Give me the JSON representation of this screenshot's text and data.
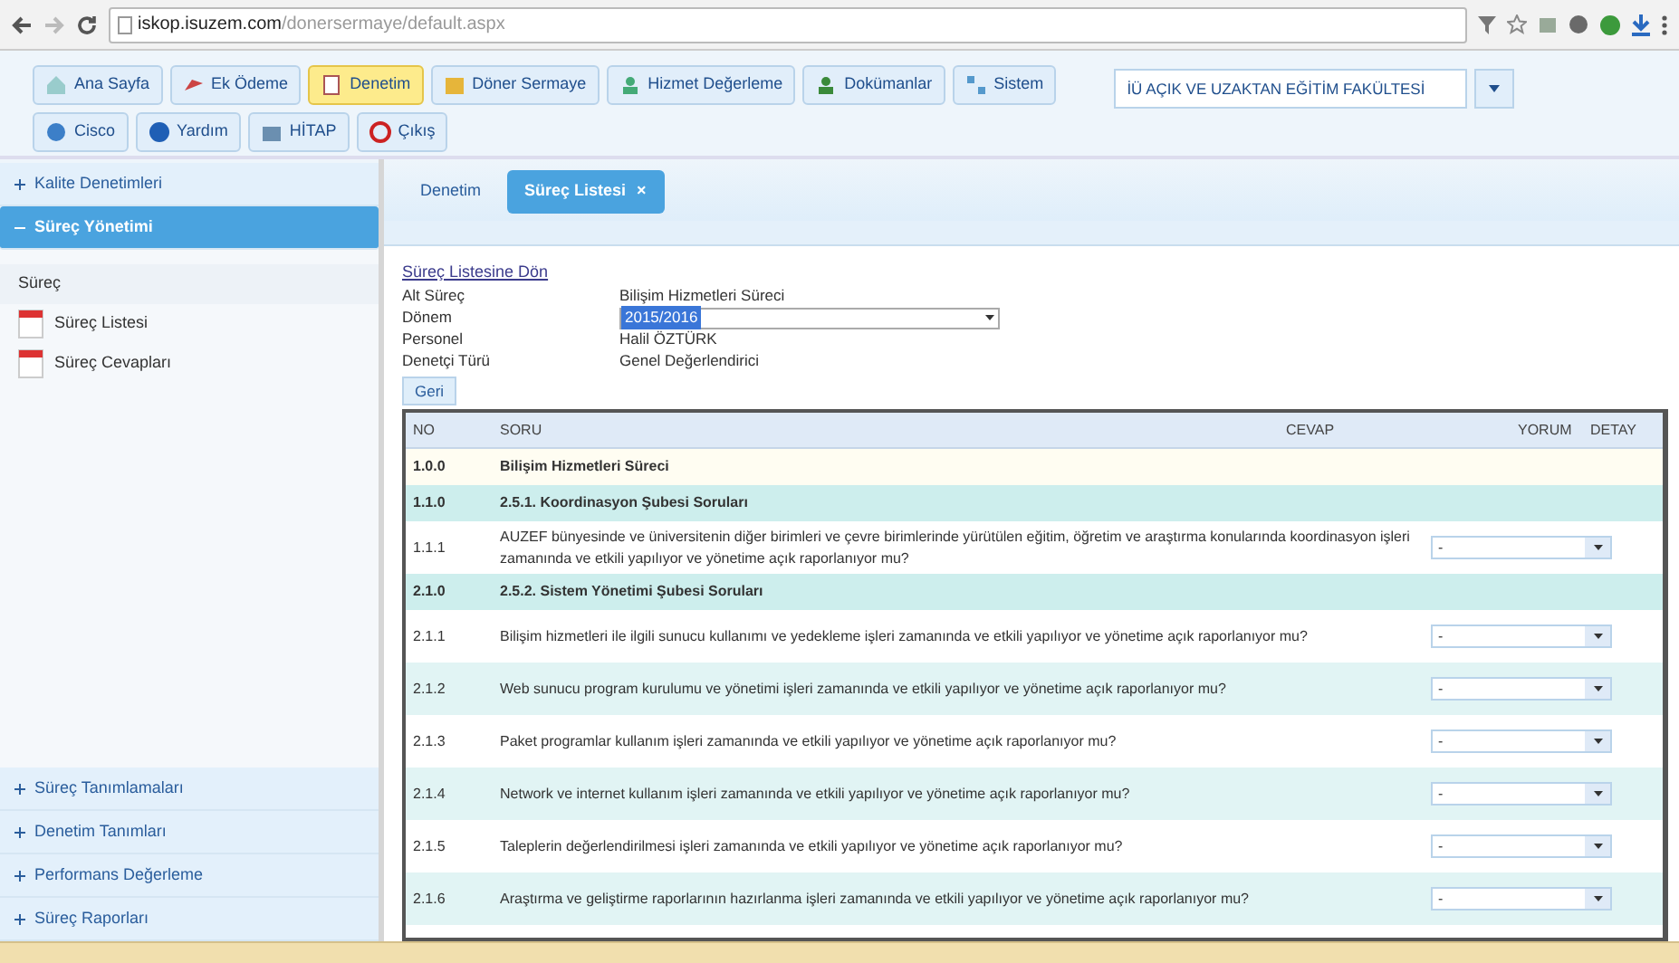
{
  "browser": {
    "url_host": "iskop.isuzem.com",
    "url_path": "/donersermaye/default.aspx"
  },
  "menu": {
    "rows": [
      [
        {
          "label": "Ana Sayfa",
          "selected": false
        },
        {
          "label": "Ek Ödeme",
          "selected": false
        },
        {
          "label": "Denetim",
          "selected": true
        },
        {
          "label": "Döner Sermaye",
          "selected": false
        },
        {
          "label": "Hizmet Değerleme",
          "selected": false
        },
        {
          "label": "Dokümanlar",
          "selected": false
        },
        {
          "label": "Sistem",
          "selected": false
        }
      ],
      [
        {
          "label": "Cisco",
          "selected": false
        },
        {
          "label": "Yardım",
          "selected": false
        },
        {
          "label": "HİTAP",
          "selected": false
        },
        {
          "label": "Çıkış",
          "selected": false
        }
      ]
    ]
  },
  "faculty_select": {
    "value": "İÜ AÇIK VE UZAKTAN EĞİTİM FAKÜLTESİ"
  },
  "sidebar": {
    "sections": [
      {
        "label": "Kalite Denetimleri",
        "expanded": false
      },
      {
        "label": "Süreç Yönetimi",
        "expanded": true,
        "heading": "Süreç",
        "items": [
          "Süreç Listesi",
          "Süreç Cevapları"
        ]
      },
      {
        "label": "Süreç Tanımlamaları",
        "expanded": false
      },
      {
        "label": "Denetim Tanımları",
        "expanded": false
      },
      {
        "label": "Performans Değerleme",
        "expanded": false
      },
      {
        "label": "Süreç Raporları",
        "expanded": false
      }
    ]
  },
  "tabs": [
    {
      "label": "Denetim",
      "selected": false
    },
    {
      "label": "Süreç Listesi",
      "selected": true,
      "close": "×"
    }
  ],
  "form": {
    "back_link": "Süreç Listesine Dön",
    "fields": [
      {
        "label": "Alt Süreç",
        "kind": "text",
        "value": "Bilişim Hizmetleri Süreci"
      },
      {
        "label": "Dönem",
        "kind": "select",
        "value": "2015/2016"
      },
      {
        "label": "Personel",
        "kind": "text",
        "value": "Halil ÖZTÜRK"
      },
      {
        "label": "Denetçi Türü",
        "kind": "text",
        "value": "Genel Değerlendirici"
      }
    ],
    "button": "Geri"
  },
  "table": {
    "columns": [
      "NO",
      "SORU",
      "CEVAP",
      "YORUM",
      "DETAY"
    ],
    "rows": [
      {
        "kind": "group",
        "no": "1.0.0",
        "text": "Bilişim Hizmetleri Süreci"
      },
      {
        "kind": "section",
        "no": "1.1.0",
        "text": "2.5.1. Koordinasyon Şubesi Soruları"
      },
      {
        "kind": "question",
        "no": "1.1.1",
        "text": "AUZEF bünyesinde ve üniversitenin diğer birimleri ve çevre birimlerinde yürütülen eğitim, öğretim ve araştırma konularında koordinasyon işleri zamanında ve etkili yapılıyor ve yönetime açık raporlanıyor mu?",
        "answer": "-"
      },
      {
        "kind": "section",
        "no": "2.1.0",
        "text": "2.5.2. Sistem Yönetimi Şubesi Soruları"
      },
      {
        "kind": "question",
        "no": "2.1.1",
        "text": "Bilişim hizmetleri ile ilgili sunucu kullanımı ve yedekleme işleri zamanında ve etkili yapılıyor ve yönetime açık raporlanıyor mu?",
        "answer": "-"
      },
      {
        "kind": "question",
        "no": "2.1.2",
        "text": "Web sunucu program kurulumu ve yönetimi işleri zamanında ve etkili yapılıyor ve yönetime açık raporlanıyor mu?",
        "answer": "-"
      },
      {
        "kind": "question",
        "no": "2.1.3",
        "text": "Paket programlar kullanım işleri zamanında ve etkili yapılıyor ve yönetime açık raporlanıyor mu?",
        "answer": "-"
      },
      {
        "kind": "question",
        "no": "2.1.4",
        "text": "Network ve internet kullanım işleri zamanında ve etkili yapılıyor ve yönetime açık raporlanıyor mu?",
        "answer": "-"
      },
      {
        "kind": "question",
        "no": "2.1.5",
        "text": "Taleplerin değerlendirilmesi işleri zamanında ve etkili yapılıyor ve yönetime açık raporlanıyor mu?",
        "answer": "-"
      },
      {
        "kind": "question",
        "no": "2.1.6",
        "text": "Araştırma ve geliştirme raporlarının hazırlanma işleri zamanında ve etkili yapılıyor ve yönetime açık raporlanıyor mu?",
        "answer": "-"
      }
    ]
  }
}
